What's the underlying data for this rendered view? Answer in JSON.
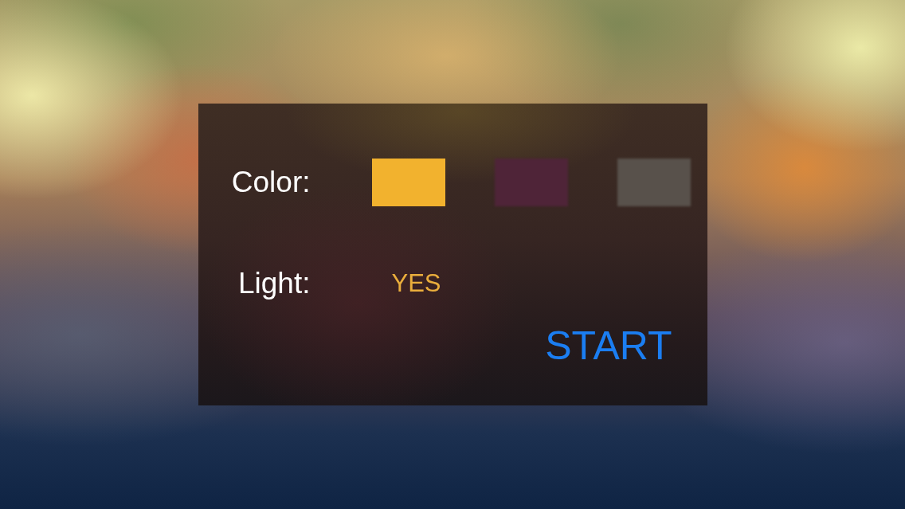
{
  "panel": {
    "rows": [
      {
        "kind": "color",
        "label": "Color:",
        "swatches": [
          {
            "color": "#f2b22e",
            "selected": true
          },
          {
            "color": "#4f2438",
            "selected": false
          },
          {
            "color": "#58514b",
            "selected": false
          }
        ]
      },
      {
        "kind": "toggle",
        "label": "Light:",
        "value": "YES"
      }
    ],
    "start_button": "START"
  }
}
